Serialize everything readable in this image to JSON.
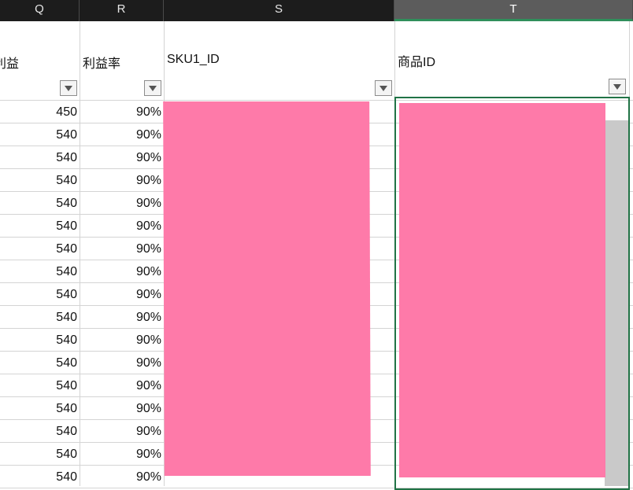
{
  "sheet": {
    "columns": [
      {
        "letter": "Q",
        "header": "利益"
      },
      {
        "letter": "R",
        "header": "利益率"
      },
      {
        "letter": "S",
        "header": "SKU1_ID"
      },
      {
        "letter": "T",
        "header": "商品ID"
      }
    ],
    "selected_column": "T",
    "rows": [
      {
        "profit": "450",
        "margin": "90%"
      },
      {
        "profit": "540",
        "margin": "90%"
      },
      {
        "profit": "540",
        "margin": "90%"
      },
      {
        "profit": "540",
        "margin": "90%"
      },
      {
        "profit": "540",
        "margin": "90%"
      },
      {
        "profit": "540",
        "margin": "90%"
      },
      {
        "profit": "540",
        "margin": "90%"
      },
      {
        "profit": "540",
        "margin": "90%"
      },
      {
        "profit": "540",
        "margin": "90%"
      },
      {
        "profit": "540",
        "margin": "90%"
      },
      {
        "profit": "540",
        "margin": "90%"
      },
      {
        "profit": "540",
        "margin": "90%"
      },
      {
        "profit": "540",
        "margin": "90%"
      },
      {
        "profit": "540",
        "margin": "90%"
      },
      {
        "profit": "540",
        "margin": "90%"
      },
      {
        "profit": "540",
        "margin": "90%"
      },
      {
        "profit": "540",
        "margin": "90%"
      }
    ],
    "filter_icon": "dropdown-arrow-icon",
    "colors": {
      "redaction": "#fe7aa9",
      "selection_border": "#217346",
      "header_bg": "#1c1c1c"
    }
  }
}
